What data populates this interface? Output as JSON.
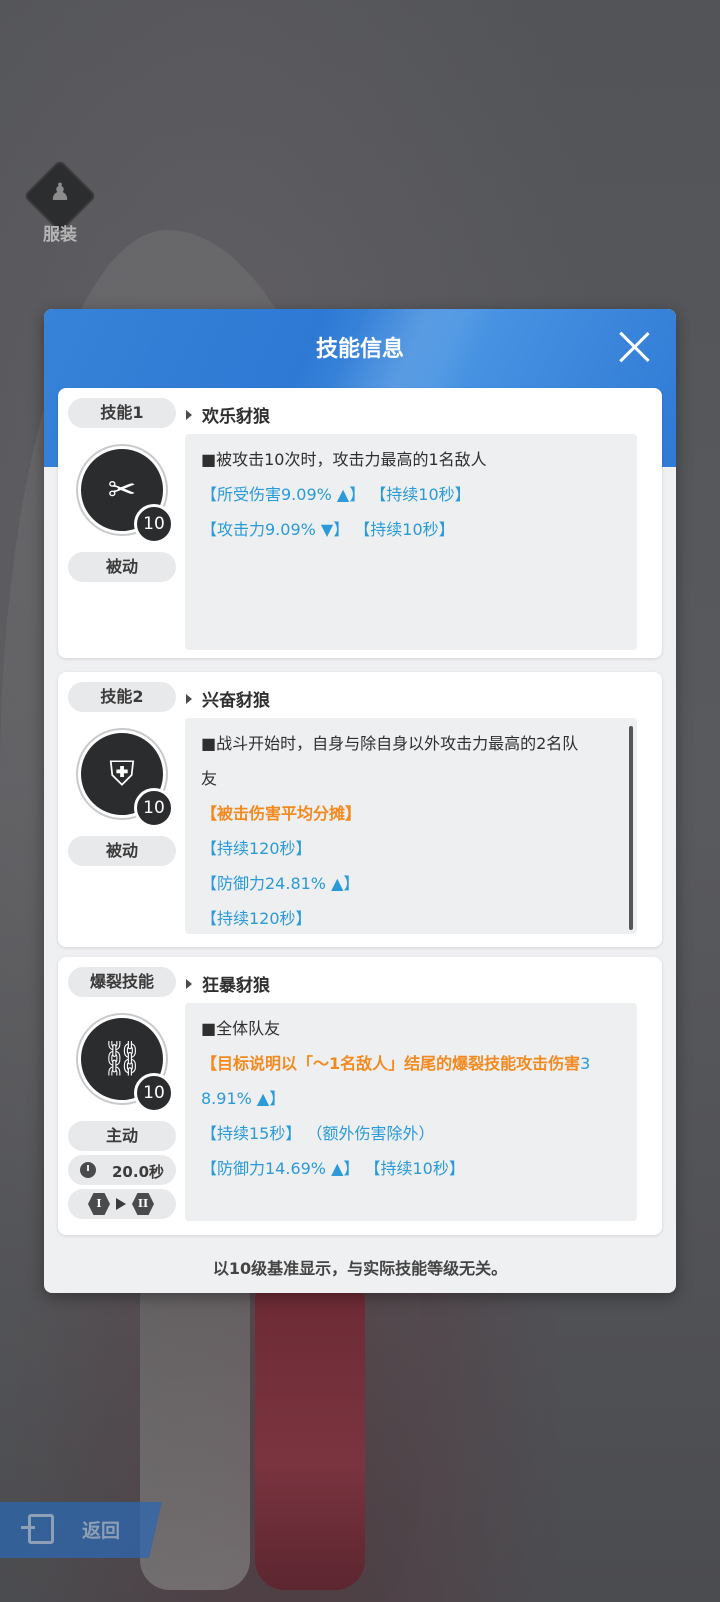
{
  "background": {
    "outfit_button": {
      "label": "服装",
      "icon": "person-icon"
    },
    "back_button": {
      "label": "返回",
      "icon": "exit-icon"
    }
  },
  "dialog": {
    "title": "技能信息",
    "close_icon": "close-icon",
    "footnote": "以10级基准显示，与实际技能等级无关。",
    "skills": [
      {
        "slot_label": "技能1",
        "name": "欢乐豺狼",
        "level": "10",
        "type": "被动",
        "icon": "crossed-bullet-icon",
        "lines": [
          {
            "text": "■被攻击10次时，攻击力最高的1名敌人"
          },
          {
            "text": "【所受伤害9.09% ▲】 【持续10秒】"
          },
          {
            "text": "【攻击力9.09% ▼】 【持续10秒】"
          }
        ]
      },
      {
        "slot_label": "技能2",
        "name": "兴奋豺狼",
        "level": "10",
        "type": "被动",
        "icon": "shield-up-icon",
        "lines": [
          {
            "text": "■战斗开始时，自身与除自身以外攻击力最高的2名队"
          },
          {
            "text": "友"
          },
          {
            "text": "【被击伤害平均分摊】"
          },
          {
            "text": "【持续120秒】"
          },
          {
            "text": "【防御力24.81% ▲】"
          },
          {
            "text": "【持续120秒】"
          }
        ]
      },
      {
        "slot_label": "爆裂技能",
        "name": "狂暴豺狼",
        "level": "10",
        "type": "主动",
        "cooldown": "20.0秒",
        "burst_from": "I",
        "burst_to": "II",
        "icon": "broken-chain-icon",
        "lines": [
          {
            "text": "■全体队友"
          },
          {
            "text": "【目标说明以「～1名敌人」结尾的爆裂技能攻击伤害",
            "tail": "3"
          },
          {
            "text": "8.91% ▲】"
          },
          {
            "text": "【持续15秒】",
            "tail": "（额外伤害除外）"
          },
          {
            "text": "【防御力14.69% ▲】 【持续10秒】"
          }
        ]
      }
    ]
  }
}
